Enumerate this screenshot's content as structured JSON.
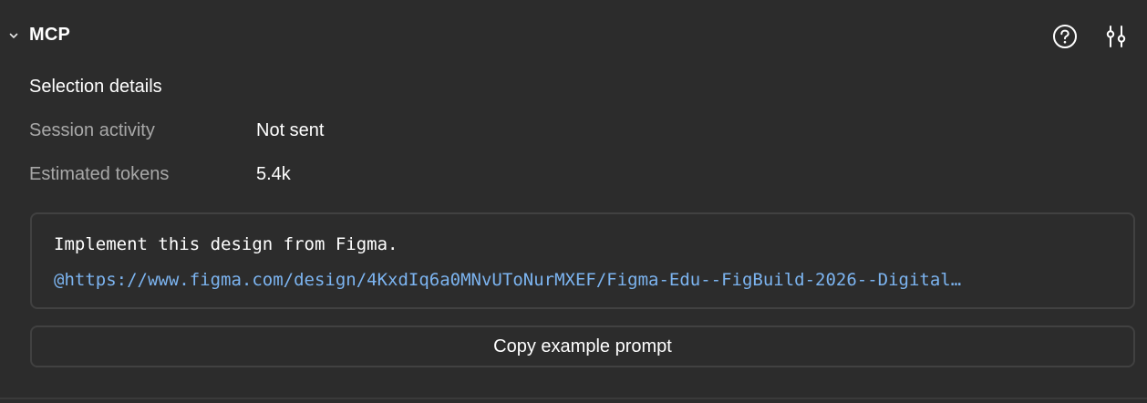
{
  "header": {
    "title": "MCP",
    "icons": {
      "collapse": "chevron-down-icon",
      "help": "help-circle-icon",
      "settings": "sliders-icon"
    }
  },
  "selection_details": {
    "title": "Selection details",
    "rows": [
      {
        "label": "Session activity",
        "value": "Not sent"
      },
      {
        "label": "Estimated tokens",
        "value": "5.4k"
      }
    ]
  },
  "prompt": {
    "line1": "Implement this design from Figma.",
    "link": "@https://www.figma.com/design/4KxdIq6a0MNvUToNurMXEF/Figma-Edu--FigBuild-2026--Digital…"
  },
  "copy_button": {
    "label": "Copy example prompt"
  },
  "colors": {
    "background": "#2c2c2c",
    "border": "#414141",
    "muted_text": "#a8a8a8",
    "link": "#7cb4f0"
  }
}
